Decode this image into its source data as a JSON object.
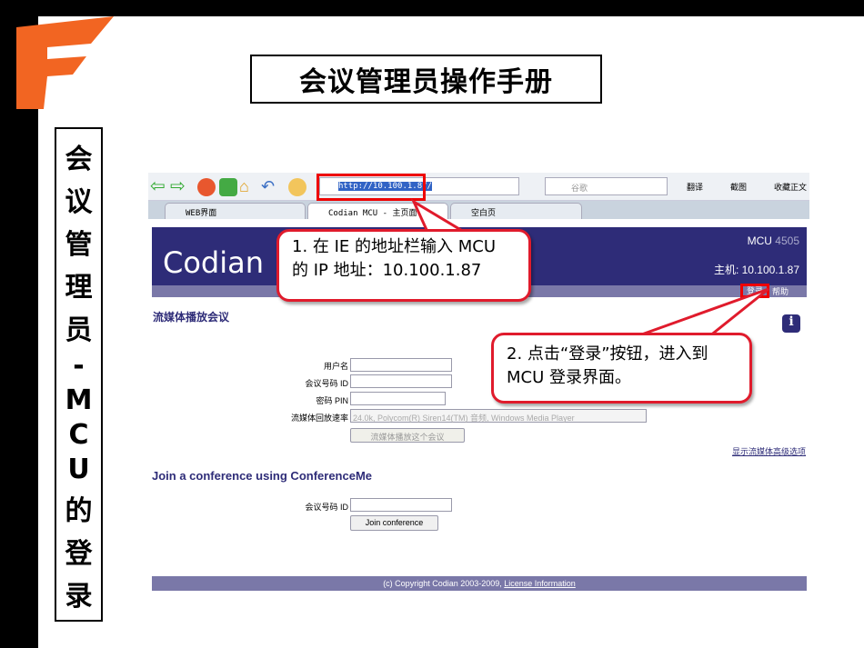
{
  "slide": {
    "title": "会议管理员操作手册",
    "side_title": [
      "会",
      "议",
      "管",
      "理",
      "员",
      "-",
      "M",
      "C",
      "U",
      "的",
      "登",
      "录"
    ]
  },
  "browser": {
    "url": "http://10.100.1.87/",
    "search_placeholder": "谷歌",
    "translate": "翻译",
    "screenshot": "截图",
    "favorite": "收藏正文",
    "tabs": [
      {
        "label": "WEB界面"
      },
      {
        "label": "Codian MCU - 主页面"
      },
      {
        "label": "空白页"
      }
    ]
  },
  "page": {
    "logo": "Codian",
    "model_label": "MCU",
    "model": "4505",
    "host": "主机: 10.100.1.87",
    "login": "登录",
    "help": "帮助",
    "stream_heading": "流媒体播放会议",
    "fields": [
      {
        "label": "用户名"
      },
      {
        "label": "会议号码 ID"
      },
      {
        "label": "密码 PIN"
      }
    ],
    "rate_label": "流媒体回放速率",
    "rate_value": "24.0k, Polycom(R) Siren14(TM) 音频, Windows Media Player",
    "stream_button": "流媒体播放这个会议",
    "advanced_link": "显示流媒体高级选项",
    "join_heading": "Join a conference using ConferenceMe",
    "join_label": "会议号码 ID",
    "join_button": "Join conference",
    "copyright": "(c) Copyright Codian 2003-2009, ",
    "license": "License Information"
  },
  "callouts": [
    "1. 在 IE 的地址栏输入 MCU 的 IP 地址：10.100.1.87",
    "2. 点击“登录”按钮，进入到 MCU 登录界面。"
  ]
}
